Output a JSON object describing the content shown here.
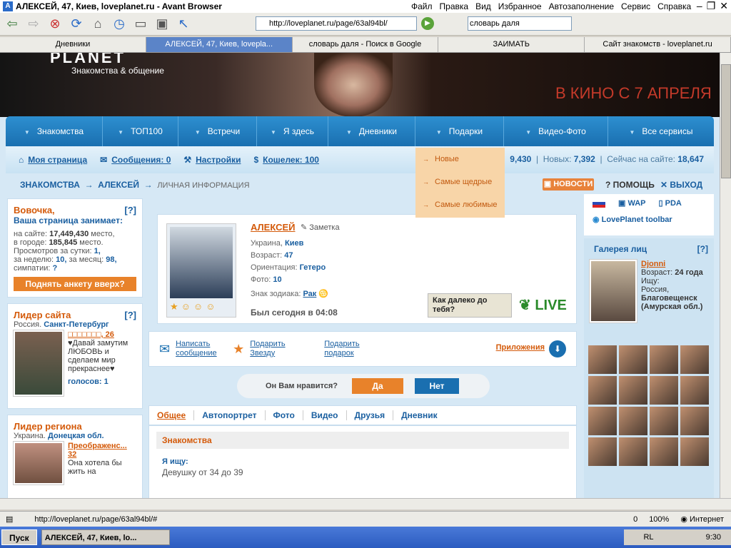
{
  "window": {
    "title": "АЛЕКСЕЙ, 47, Киев, loveplanet.ru - Avant Browser",
    "menus": [
      "Файл",
      "Правка",
      "Вид",
      "Избранное",
      "Автозаполнение",
      "Сервис",
      "Справка"
    ]
  },
  "address": {
    "url": "http://loveplanet.ru/page/63al94bl/"
  },
  "search": {
    "value": "словарь даля"
  },
  "tabs": [
    "Дневники",
    "АЛЕКСЕЙ, 47, Киев, lovepla...",
    "словарь даля - Поиск в Google",
    "ЗАИМАТЬ",
    "Сайт знакомств - loveplanet.ru"
  ],
  "banner": {
    "logo": "PLANET",
    "logo_sub": "Знакомства & общение",
    "promo": "В КИНО С 7 АПРЕЛЯ"
  },
  "nav": [
    "Знакомства",
    "ТОП100",
    "Встречи",
    "Я здесь",
    "Дневники",
    "Подарки",
    "Видео-Фото",
    "Все сервисы"
  ],
  "subnav": {
    "mypage": "Моя страница",
    "messages": "Сообщения: 0",
    "settings": "Настройки",
    "wallet": "Кошелек: 100"
  },
  "stats": {
    "total": "9,430",
    "new_label": "Новых:",
    "new": "7,392",
    "online_label": "Сейчас на сайте:",
    "online": "18,647"
  },
  "dropdown": [
    "Новые",
    "Самые щедрые",
    "Самые любимые"
  ],
  "crumbs": {
    "c1": "ЗНАКОМСТВА",
    "c2": "АЛЕКСЕЙ",
    "c3": "ЛИЧНАЯ ИНФОРМАЦИЯ"
  },
  "toplinks": {
    "news": "НОВОСТИ",
    "help": "ПОМОЩЬ",
    "exit": "ВЫХОД"
  },
  "leftbox": {
    "name": "Вовочка,",
    "line1": "Ваша страница занимает:",
    "site_l": "на сайте:",
    "site": "17,449,430",
    "site_s": "место,",
    "city_l": "в городе:",
    "city": "185,845",
    "city_s": "место.",
    "views_l": "Просмотров за сутки:",
    "views": "1,",
    "week_l": "за неделю:",
    "week": "10,",
    "month_l": "за месяц:",
    "month": "98,",
    "sympathy_l": "симпатии:",
    "sympathy": "?",
    "upbtn": "Поднять анкету вверх?",
    "qm": "[?]"
  },
  "leader": {
    "title": "Лидер сайта",
    "qm": "[?]",
    "country": "Россия.",
    "city": "Санкт-Петербург",
    "name": "□□□□□□□, 26",
    "quote": "♥Давай замутим ЛЮБОВЬ и сделаем мир прекраснее♥",
    "votes": "голосов: 1"
  },
  "region": {
    "title": "Лидер региона",
    "country": "Украина.",
    "city": "Донецкая обл.",
    "name": "Преображенс... 32",
    "quote": "Она хотела бы жить на"
  },
  "profile": {
    "name": "АЛЕКСЕЙ",
    "note": "Заметка",
    "country": "Украина,",
    "city": "Киев",
    "age_l": "Возраст:",
    "age": "47",
    "orient_l": "Ориентация:",
    "orient": "Гетеро",
    "photo_l": "Фото:",
    "photo": "10",
    "zodiac_l": "Знак зодиака:",
    "zodiac": "Рак",
    "lastseen": "Был сегодня в 04:08",
    "howfar": "Как далеко до тебя?",
    "live": "LIVE"
  },
  "actions": {
    "write": "Написать сообщение",
    "star": "Подарить Звезду",
    "gift": "Подарить подарок",
    "apps": "Приложения"
  },
  "like": {
    "q": "Он Вам нравится?",
    "yes": "Да",
    "no": "Нет"
  },
  "ptabs": [
    "Общее",
    "Автопортрет",
    "Фото",
    "Видео",
    "Друзья",
    "Дневник"
  ],
  "pcontent": {
    "section": "Знакомства",
    "label": "Я ищу:",
    "value": "Девушку от 34 до 39"
  },
  "right": {
    "wap": "WAP",
    "pda": "PDA",
    "toolbar": "LovePlanet toolbar",
    "gallery": "Галерея лиц",
    "qm": "[?]",
    "gname": "Djonni",
    "gage_l": "Возраст:",
    "gage": "24 года",
    "seeks": "Ищу:",
    "gcountry": "Россия,",
    "gcity": "Благовещенск (Амурская обл.)"
  },
  "status": {
    "url": "http://loveplanet.ru/page/63al94bl/#",
    "count": "0",
    "zoom": "100%",
    "zone": "Интернет"
  },
  "taskbar": {
    "start": "Пуск",
    "task": "АЛЕКСЕЙ, 47, Киев, lo...",
    "lang": "RL",
    "time": "9:30"
  }
}
